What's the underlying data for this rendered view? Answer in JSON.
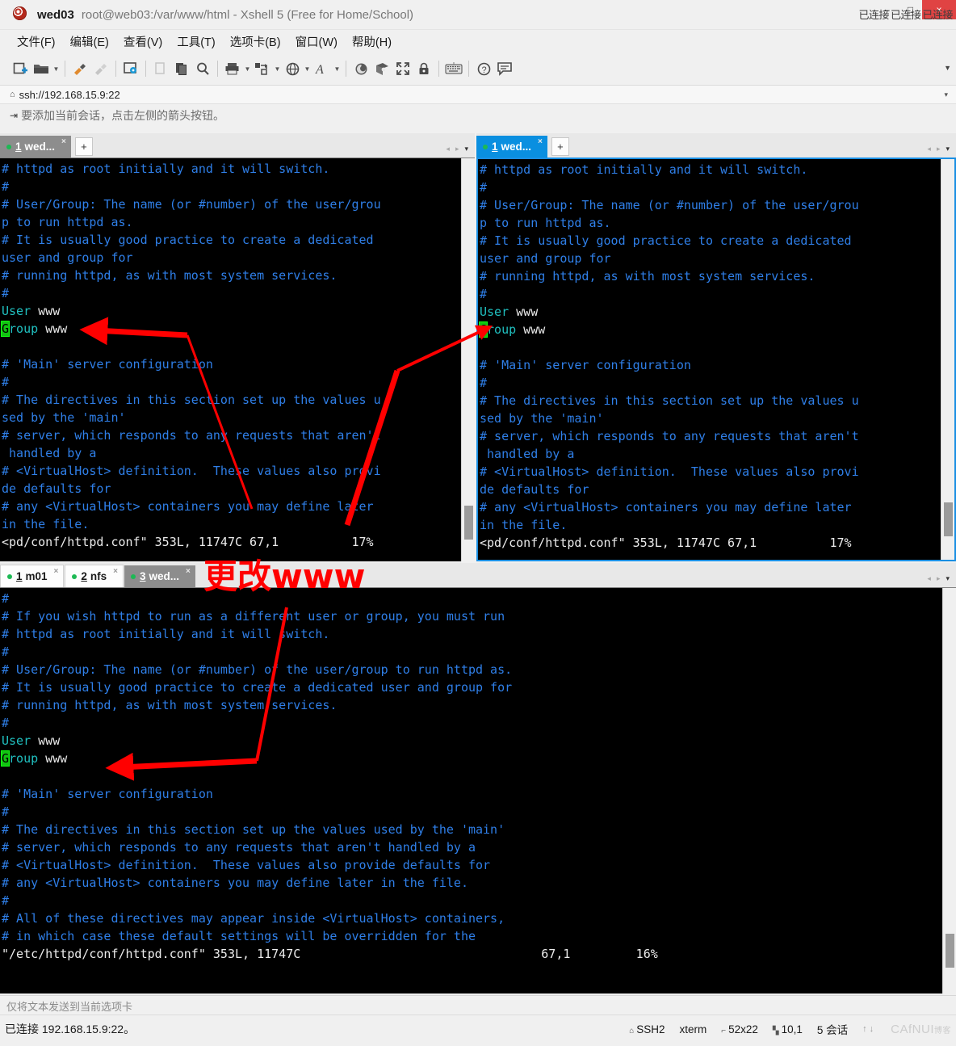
{
  "window": {
    "app_name": "wed03",
    "title_path": "root@web03:/var/www/html - Xshell 5 (Free for Home/School)",
    "app_icon": "xshell-logo-icon",
    "minimize_label": "–",
    "maximize_label": "□",
    "close_label": "×",
    "connected_overlay": [
      "已连接",
      "已连接",
      "已连接"
    ]
  },
  "menubar": [
    {
      "label": "文件(F)",
      "name": "menu-file"
    },
    {
      "label": "编辑(E)",
      "name": "menu-edit"
    },
    {
      "label": "查看(V)",
      "name": "menu-view"
    },
    {
      "label": "工具(T)",
      "name": "menu-tools"
    },
    {
      "label": "选项卡(B)",
      "name": "menu-tabs"
    },
    {
      "label": "窗口(W)",
      "name": "menu-window"
    },
    {
      "label": "帮助(H)",
      "name": "menu-help"
    }
  ],
  "toolbar": {
    "icons": [
      "new-session-icon",
      "open-folder-icon",
      "open-folder-caret",
      "separator",
      "connect-icon",
      "disconnect-icon",
      "separator",
      "session-properties-icon",
      "separator",
      "copy-icon",
      "paste-icon",
      "find-icon",
      "separator",
      "print-icon",
      "print-caret",
      "transfer-icon",
      "transfer-caret",
      "web-icon",
      "web-caret",
      "font-icon",
      "font-caret",
      "separator",
      "xshell-icon",
      "xftp-icon",
      "fullscreen-icon",
      "lock-icon",
      "separator",
      "keyboard-icon",
      "separator",
      "help-icon",
      "comment-icon"
    ],
    "overflow_label": "▼"
  },
  "address": {
    "lock_icon": "lock-icon",
    "value": "ssh://192.168.15.9:22",
    "caret": "▾"
  },
  "notice": {
    "icon": "add-session-arrow-icon",
    "text": "要添加当前会话，点击左侧的箭头按钮。"
  },
  "panes": {
    "top_left": {
      "tabs": [
        {
          "num": "1",
          "label": "wed...",
          "state": "active",
          "close": "×",
          "dot": "session-connected-dot"
        }
      ],
      "add_tab_label": "+",
      "nav": {
        "prev": "◂",
        "next": "▸",
        "list": "▾"
      },
      "lines": [
        {
          "segs": [
            {
              "t": "# httpd as root initially and it will switch.",
              "c": "blue"
            }
          ]
        },
        {
          "segs": [
            {
              "t": "#",
              "c": "blue"
            }
          ]
        },
        {
          "segs": [
            {
              "t": "# User/Group: The name (or #number) of the user/grou",
              "c": "blue"
            }
          ]
        },
        {
          "segs": [
            {
              "t": "p to run httpd as.",
              "c": "blue"
            }
          ]
        },
        {
          "segs": [
            {
              "t": "# It is usually good practice to create a dedicated",
              "c": "blue"
            }
          ]
        },
        {
          "segs": [
            {
              "t": "user and group for",
              "c": "blue"
            }
          ]
        },
        {
          "segs": [
            {
              "t": "# running httpd, as with most system services.",
              "c": "blue"
            }
          ]
        },
        {
          "segs": [
            {
              "t": "#",
              "c": "blue"
            }
          ]
        },
        {
          "segs": [
            {
              "t": "User",
              "c": "cyan"
            },
            {
              "t": " www",
              "c": "white"
            }
          ]
        },
        {
          "segs": [
            {
              "t": "G",
              "c": "cursor"
            },
            {
              "t": "roup",
              "c": "cyan"
            },
            {
              "t": " www",
              "c": "white"
            }
          ]
        },
        {
          "segs": [
            {
              "t": "",
              "c": "blue"
            }
          ]
        },
        {
          "segs": [
            {
              "t": "# 'Main' server configuration",
              "c": "blue"
            }
          ]
        },
        {
          "segs": [
            {
              "t": "#",
              "c": "blue"
            }
          ]
        },
        {
          "segs": [
            {
              "t": "# The directives in this section set up the values u",
              "c": "blue"
            }
          ]
        },
        {
          "segs": [
            {
              "t": "sed by the 'main'",
              "c": "blue"
            }
          ]
        },
        {
          "segs": [
            {
              "t": "# server, which responds to any requests that aren't",
              "c": "blue"
            }
          ]
        },
        {
          "segs": [
            {
              "t": " handled by a",
              "c": "blue"
            }
          ]
        },
        {
          "segs": [
            {
              "t": "# <VirtualHost> definition.  These values also provi",
              "c": "blue"
            }
          ]
        },
        {
          "segs": [
            {
              "t": "de defaults for",
              "c": "blue"
            }
          ]
        },
        {
          "segs": [
            {
              "t": "# any <VirtualHost> containers you may define later",
              "c": "blue"
            }
          ]
        },
        {
          "segs": [
            {
              "t": "in the file.",
              "c": "blue"
            }
          ]
        },
        {
          "segs": [
            {
              "t": "<pd/conf/httpd.conf\" 353L, 11747C 67,1          17%",
              "c": "status"
            }
          ]
        }
      ]
    },
    "top_right": {
      "tabs": [
        {
          "num": "1",
          "label": "wed...",
          "state": "focused",
          "close": "×",
          "dot": "session-connected-dot"
        }
      ],
      "add_tab_label": "+",
      "nav": {
        "prev": "◂",
        "next": "▸",
        "list": "▾"
      },
      "lines": [
        {
          "segs": [
            {
              "t": "# httpd as root initially and it will switch.",
              "c": "blue"
            }
          ]
        },
        {
          "segs": [
            {
              "t": "#",
              "c": "blue"
            }
          ]
        },
        {
          "segs": [
            {
              "t": "# User/Group: The name (or #number) of the user/grou",
              "c": "blue"
            }
          ]
        },
        {
          "segs": [
            {
              "t": "p to run httpd as.",
              "c": "blue"
            }
          ]
        },
        {
          "segs": [
            {
              "t": "# It is usually good practice to create a dedicated",
              "c": "blue"
            }
          ]
        },
        {
          "segs": [
            {
              "t": "user and group for",
              "c": "blue"
            }
          ]
        },
        {
          "segs": [
            {
              "t": "# running httpd, as with most system services.",
              "c": "blue"
            }
          ]
        },
        {
          "segs": [
            {
              "t": "#",
              "c": "blue"
            }
          ]
        },
        {
          "segs": [
            {
              "t": "User",
              "c": "cyan"
            },
            {
              "t": " www",
              "c": "white"
            }
          ]
        },
        {
          "segs": [
            {
              "t": "G",
              "c": "cursor"
            },
            {
              "t": "roup",
              "c": "cyan"
            },
            {
              "t": " www",
              "c": "white"
            }
          ]
        },
        {
          "segs": [
            {
              "t": "",
              "c": "blue"
            }
          ]
        },
        {
          "segs": [
            {
              "t": "# 'Main' server configuration",
              "c": "blue"
            }
          ]
        },
        {
          "segs": [
            {
              "t": "#",
              "c": "blue"
            }
          ]
        },
        {
          "segs": [
            {
              "t": "# The directives in this section set up the values u",
              "c": "blue"
            }
          ]
        },
        {
          "segs": [
            {
              "t": "sed by the 'main'",
              "c": "blue"
            }
          ]
        },
        {
          "segs": [
            {
              "t": "# server, which responds to any requests that aren't",
              "c": "blue"
            }
          ]
        },
        {
          "segs": [
            {
              "t": " handled by a",
              "c": "blue"
            }
          ]
        },
        {
          "segs": [
            {
              "t": "# <VirtualHost> definition.  These values also provi",
              "c": "blue"
            }
          ]
        },
        {
          "segs": [
            {
              "t": "de defaults for",
              "c": "blue"
            }
          ]
        },
        {
          "segs": [
            {
              "t": "# any <VirtualHost> containers you may define later",
              "c": "blue"
            }
          ]
        },
        {
          "segs": [
            {
              "t": "in the file.",
              "c": "blue"
            }
          ]
        },
        {
          "segs": [
            {
              "t": "<pd/conf/httpd.conf\" 353L, 11747C 67,1          17%",
              "c": "status"
            }
          ]
        }
      ]
    },
    "bottom": {
      "tabs": [
        {
          "num": "1",
          "label": "m01",
          "state": "inactive",
          "close": "×",
          "dot": "session-connected-dot"
        },
        {
          "num": "2",
          "label": "nfs",
          "state": "inactive",
          "close": "×",
          "dot": "session-connected-dot"
        },
        {
          "num": "3",
          "label": "wed...",
          "state": "active",
          "close": "×",
          "dot": "session-connected-dot"
        }
      ],
      "nav": {
        "prev": "◂",
        "next": "▸",
        "list": "▾"
      },
      "lines": [
        {
          "segs": [
            {
              "t": "#",
              "c": "blue"
            }
          ]
        },
        {
          "segs": [
            {
              "t": "# If you wish httpd to run as a different user or group, you must run",
              "c": "blue"
            }
          ]
        },
        {
          "segs": [
            {
              "t": "# httpd as root initially and it will switch.",
              "c": "blue"
            }
          ]
        },
        {
          "segs": [
            {
              "t": "#",
              "c": "blue"
            }
          ]
        },
        {
          "segs": [
            {
              "t": "# User/Group: The name (or #number) of the user/group to run httpd as.",
              "c": "blue"
            }
          ]
        },
        {
          "segs": [
            {
              "t": "# It is usually good practice to create a dedicated user and group for",
              "c": "blue"
            }
          ]
        },
        {
          "segs": [
            {
              "t": "# running httpd, as with most system services.",
              "c": "blue"
            }
          ]
        },
        {
          "segs": [
            {
              "t": "#",
              "c": "blue"
            }
          ]
        },
        {
          "segs": [
            {
              "t": "User",
              "c": "cyan"
            },
            {
              "t": " www",
              "c": "white"
            }
          ]
        },
        {
          "segs": [
            {
              "t": "G",
              "c": "cursor"
            },
            {
              "t": "roup",
              "c": "cyan"
            },
            {
              "t": " www",
              "c": "white"
            }
          ]
        },
        {
          "segs": [
            {
              "t": "",
              "c": "blue"
            }
          ]
        },
        {
          "segs": [
            {
              "t": "# 'Main' server configuration",
              "c": "blue"
            }
          ]
        },
        {
          "segs": [
            {
              "t": "#",
              "c": "blue"
            }
          ]
        },
        {
          "segs": [
            {
              "t": "# The directives in this section set up the values used by the 'main'",
              "c": "blue"
            }
          ]
        },
        {
          "segs": [
            {
              "t": "# server, which responds to any requests that aren't handled by a",
              "c": "blue"
            }
          ]
        },
        {
          "segs": [
            {
              "t": "# <VirtualHost> definition.  These values also provide defaults for",
              "c": "blue"
            }
          ]
        },
        {
          "segs": [
            {
              "t": "# any <VirtualHost> containers you may define later in the file.",
              "c": "blue"
            }
          ]
        },
        {
          "segs": [
            {
              "t": "#",
              "c": "blue"
            }
          ]
        },
        {
          "segs": [
            {
              "t": "# All of these directives may appear inside <VirtualHost> containers,",
              "c": "blue"
            }
          ]
        },
        {
          "segs": [
            {
              "t": "# in which case these default settings will be overridden for the",
              "c": "blue"
            }
          ]
        },
        {
          "segs": [
            {
              "t": "\"/etc/httpd/conf/httpd.conf\" 353L, 11747C                                 67,1         16%",
              "c": "status"
            }
          ]
        }
      ]
    }
  },
  "send_bar": {
    "text": "仅将文本发送到当前选项卡"
  },
  "status_bar": {
    "left": "已连接 192.168.15.9:22。",
    "protocol": "SSH2",
    "term_type": "xterm",
    "size": "52x22",
    "cursor_pos": "10,1",
    "sessions": "5 会话",
    "arrows": "↑↓",
    "watermark": "CAfNUI",
    "watermark_small": "博客"
  },
  "annotations": {
    "note_text": "更改www",
    "color": "#ff0000",
    "arrows": [
      {
        "name": "arrow-to-left-group-line"
      },
      {
        "name": "arrow-to-right-group-line"
      },
      {
        "name": "arrow-to-bottom-user-line"
      }
    ]
  }
}
